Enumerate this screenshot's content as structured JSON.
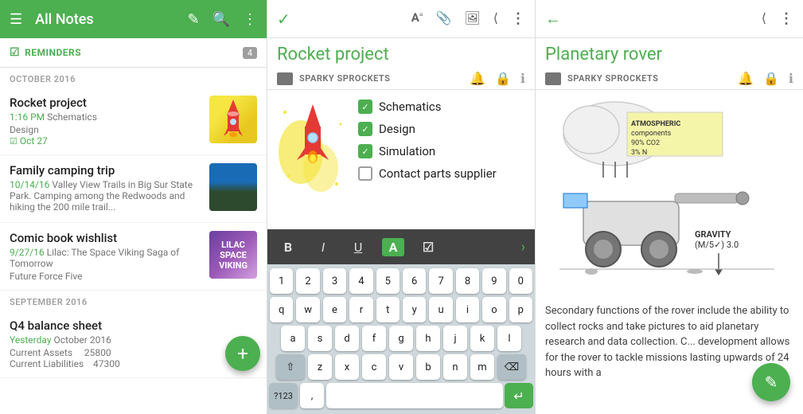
{
  "panel1": {
    "header": {
      "title": "All Notes",
      "menu_icon": "☰",
      "edit_icon": "✎",
      "search_icon": "🔍",
      "more_icon": "⋮"
    },
    "reminders": {
      "label": "REMINDERS",
      "badge": "4"
    },
    "sections": [
      {
        "label": "OCTOBER 2016",
        "notes": [
          {
            "title": "Rocket project",
            "meta_date": "1:16 PM",
            "meta_tag": "Schematics",
            "category": "Design",
            "reminder": "Oct 27",
            "thumb_type": "rocket"
          },
          {
            "title": "Family camping trip",
            "meta_date": "10/14/16",
            "meta_tag": "Valley View Trails in Big Sur State Park. Camping among the Redwoods and hiking the 200 mile trail...",
            "thumb_type": "camping"
          }
        ]
      },
      {
        "label": "",
        "notes": [
          {
            "title": "Comic book wishlist",
            "meta_date": "9/27/16",
            "meta_tag": "Lilac: The Space Viking Saga of Tomorrow",
            "desc2": "Future Force Five",
            "thumb_type": "comic"
          }
        ]
      },
      {
        "label": "SEPTEMBER 2016",
        "notes": [
          {
            "title": "Q4 balance sheet",
            "meta_date": "Yesterday",
            "meta_tag": "October 2016",
            "line1": "Current Assets    25800",
            "line2": "Current Liabilities    47300",
            "thumb_type": "none"
          }
        ]
      }
    ],
    "fab_label": "+"
  },
  "panel2": {
    "header": {
      "check_icon": "✓",
      "format_icon": "A",
      "attach_icon": "📎",
      "image_icon": "🖼",
      "share_icon": "⋮",
      "more_icon": "⋮"
    },
    "title": "Rocket project",
    "notebook": "SPARKY SPROCKETS",
    "checklist": [
      {
        "label": "Schematics",
        "checked": true
      },
      {
        "label": "Design",
        "checked": true
      },
      {
        "label": "Simulation",
        "checked": true
      },
      {
        "label": "Contact parts supplier",
        "checked": false
      }
    ],
    "formatting": {
      "bold": "B",
      "italic": "I",
      "underline": "U",
      "font": "A",
      "check": "☑",
      "arrow": "›"
    },
    "keyboard": {
      "numbers": [
        "1",
        "2",
        "3",
        "4",
        "5",
        "6",
        "7",
        "8",
        "9",
        "0"
      ],
      "row1": [
        "q",
        "w",
        "e",
        "r",
        "t",
        "y",
        "u",
        "i",
        "o",
        "p"
      ],
      "row2": [
        "a",
        "s",
        "d",
        "f",
        "g",
        "h",
        "j",
        "k",
        "l"
      ],
      "row3": [
        "z",
        "x",
        "c",
        "v",
        "b",
        "n",
        "m"
      ],
      "shift": "⇧",
      "backspace": "⌫",
      "num_switch": "?123",
      "comma": ",",
      "enter": "↵"
    }
  },
  "panel3": {
    "header": {
      "back_icon": "←",
      "share_icon": "⋮",
      "more_icon": "⋮"
    },
    "title": "Planetary rover",
    "notebook": "SPARKY SPROCKETS",
    "description": "Secondary functions of the rover include the ability to collect rocks and take pictures to aid planetary research and data collection. C... development allows for the rover to tackle missions lasting upwards of 24 hours with a",
    "illustration": {
      "cloud_text": "ATMOSPHERIC components 90% CO2 3% N",
      "gravity_text": "GRAVITY (M/5✓) 3.0"
    },
    "fab_icon": "✎"
  }
}
